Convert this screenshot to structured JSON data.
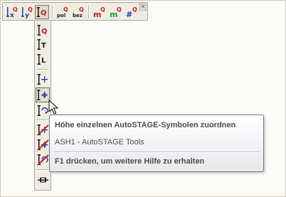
{
  "toolbar": {
    "buttons": [
      {
        "name": "x-marker-button",
        "icon": "x-axis-marker-icon"
      },
      {
        "name": "y-marker-button",
        "icon": "y-axis-marker-icon"
      },
      {
        "name": "vertical-marker-button",
        "icon": "vertical-marker-icon",
        "active": true
      },
      {
        "name": "pol-marker-button",
        "icon": "pol-marker-icon",
        "label": "pol"
      },
      {
        "name": "bez-marker-button",
        "icon": "bez-marker-icon",
        "label": "bez"
      },
      {
        "name": "m-marker-red-button",
        "icon": "m-red-icon",
        "label": "m"
      },
      {
        "name": "m-marker-green-button",
        "icon": "m-green-icon",
        "label": "m"
      },
      {
        "name": "hash-marker-button",
        "icon": "hash-icon",
        "label": "#"
      }
    ],
    "close_label": "×",
    "colors": {
      "accent_red": "#cc1a1a",
      "blue": "#1c3e95",
      "green": "#1f9a2b"
    }
  },
  "dropdown": {
    "items": [
      {
        "name": "assign-q-button",
        "letter": "Q"
      },
      {
        "name": "assign-t-button",
        "letter": "T"
      },
      {
        "name": "assign-l-button",
        "letter": "L"
      },
      {
        "name": "assign-cross-button",
        "letter": ""
      },
      {
        "name": "assign-single-symbols-button",
        "letter": "",
        "hovered": true
      },
      {
        "name": "assign-rotate-button",
        "letter": ""
      },
      {
        "name": "remove-cross-button",
        "letter": ""
      },
      {
        "name": "remove-single-button",
        "letter": ""
      },
      {
        "name": "remove-all-button",
        "letter": ""
      },
      {
        "name": "dock-bracket-button",
        "letter": ""
      }
    ]
  },
  "tooltip": {
    "title": "Höhe einzelnen AutoSTAGE-Symbolen zuordnen",
    "subtitle": "ASH1 - AutoSTAGE Tools",
    "help": "F1 drücken, um weitere Hilfe zu erhalten"
  }
}
